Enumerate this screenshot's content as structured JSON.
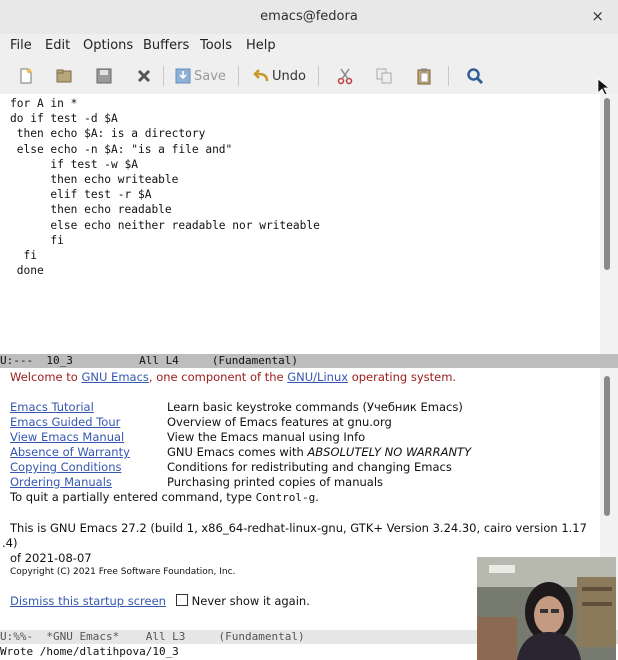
{
  "window": {
    "title": "emacs@fedora",
    "close_glyph": "×"
  },
  "menu": [
    "File",
    "Edit",
    "Options",
    "Buffers",
    "Tools",
    "Help"
  ],
  "toolbar": {
    "save_label": "Save",
    "undo_label": "Undo"
  },
  "editor": {
    "lines": [
      "for A in *",
      "do if test -d $A",
      " then echo $A: is a directory",
      " else echo -n $A: \"is a file and\"",
      "      if test -w $A",
      "      then echo writeable",
      "      elif test -r $A",
      "      then echo readable",
      "      else echo neither readable nor writeable",
      "      fi",
      "  fi",
      " done"
    ]
  },
  "modeline_top": "U:---  10_3          All L4     (Fundamental)",
  "startup": {
    "welcome_prefix": "Welcome to ",
    "welcome_link1": "GNU Emacs",
    "welcome_mid": ", one component of the ",
    "welcome_link2": "GNU/Linux",
    "welcome_suffix": " operating system.",
    "links": [
      {
        "label": "Emacs Tutorial",
        "desc": "Learn basic keystroke commands (Учебник Emacs)"
      },
      {
        "label": "Emacs Guided Tour",
        "desc": "Overview of Emacs features at gnu.org"
      },
      {
        "label": "View Emacs Manual",
        "desc": "View the Emacs manual using Info"
      },
      {
        "label": "Absence of Warranty",
        "desc_prefix": "GNU Emacs comes with ",
        "desc_em": "ABSOLUTELY NO WARRANTY"
      },
      {
        "label": "Copying Conditions",
        "desc": "Conditions for redistributing and changing Emacs"
      },
      {
        "label": "Ordering Manuals",
        "desc": "Purchasing printed copies of manuals"
      }
    ],
    "quit_prefix": "To quit a partially entered command, type ",
    "quit_key": "Control-g",
    "quit_suffix": ".",
    "version_line1": "This is GNU Emacs 27.2 (build 1, x86_64-redhat-linux-gnu, GTK+ Version 3.24.30, cairo version 1.17",
    "version_line2": ".4)",
    "version_line3": " of 2021-08-07",
    "copyright": "Copyright (C) 2021 Free Software Foundation, Inc.",
    "dismiss_label": "Dismiss this startup screen",
    "never_show_label": "Never show it again."
  },
  "modeline_bottom": "U:%%-  *GNU Emacs*    All L3     (Fundamental)",
  "echo_area": "Wrote /home/dlatihpova/10_3"
}
